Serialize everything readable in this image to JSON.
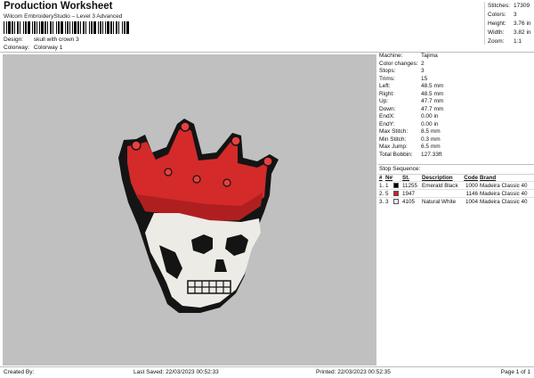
{
  "header": {
    "title": "Production Worksheet",
    "subtitle": "Wilcom EmbroideryStudio – Level 3 Advanced",
    "design_label": "Design:",
    "design_value": "skull with crown 3",
    "colorway_label": "Colorway:",
    "colorway_value": "Colorway 1"
  },
  "stats": [
    {
      "label": "Stitches:",
      "value": "17309"
    },
    {
      "label": "Colors:",
      "value": "3"
    },
    {
      "label": "Height:",
      "value": "3.76 in"
    },
    {
      "label": "Width:",
      "value": "3.82 in"
    },
    {
      "label": "Zoom:",
      "value": "1:1"
    }
  ],
  "info": [
    {
      "label": "Machine:",
      "value": "Tajima"
    },
    {
      "label": "Color changes:",
      "value": "2"
    },
    {
      "label": "Stops:",
      "value": "3"
    },
    {
      "label": "Trims:",
      "value": "15"
    },
    {
      "label": "Left:",
      "value": "48.5 mm"
    },
    {
      "label": "Right:",
      "value": "48.5 mm"
    },
    {
      "label": "Up:",
      "value": "47.7 mm"
    },
    {
      "label": "Down:",
      "value": "47.7 mm"
    },
    {
      "label": "EndX:",
      "value": "0.00 in"
    },
    {
      "label": "EndY:",
      "value": "0.00 in"
    },
    {
      "label": "Max Stitch:",
      "value": "8.5 mm"
    },
    {
      "label": "Min Stitch:",
      "value": "0.3 mm"
    },
    {
      "label": "Max Jump:",
      "value": "6.5 mm"
    },
    {
      "label": "Total Bobbin:",
      "value": "127.33ft"
    }
  ],
  "stop_sequence": {
    "title": "Stop Sequence:",
    "headers": [
      "#",
      "N#",
      "St.",
      "Description",
      "Code",
      "Brand"
    ],
    "rows": [
      {
        "num": "1.",
        "n": "1",
        "color": "#000000",
        "st": "11255",
        "desc": "Emerald Black",
        "code": "1000",
        "brand": "Madeira Classic 40"
      },
      {
        "num": "2.",
        "n": "5",
        "color": "#d42020",
        "st": "1947",
        "desc": "",
        "code": "1146",
        "brand": "Madeira Classic 40"
      },
      {
        "num": "3.",
        "n": "3",
        "color": "#f2f2ee",
        "st": "4105",
        "desc": "Natural White",
        "code": "1004",
        "brand": "Madeira Classic 40"
      }
    ]
  },
  "footer": {
    "created_by": "Created By:",
    "last_saved": "Last Saved: 22/03/2023 00:52:33",
    "printed": "Printed: 22/03/2023 00:52:35",
    "page": "Page 1 of 1"
  }
}
